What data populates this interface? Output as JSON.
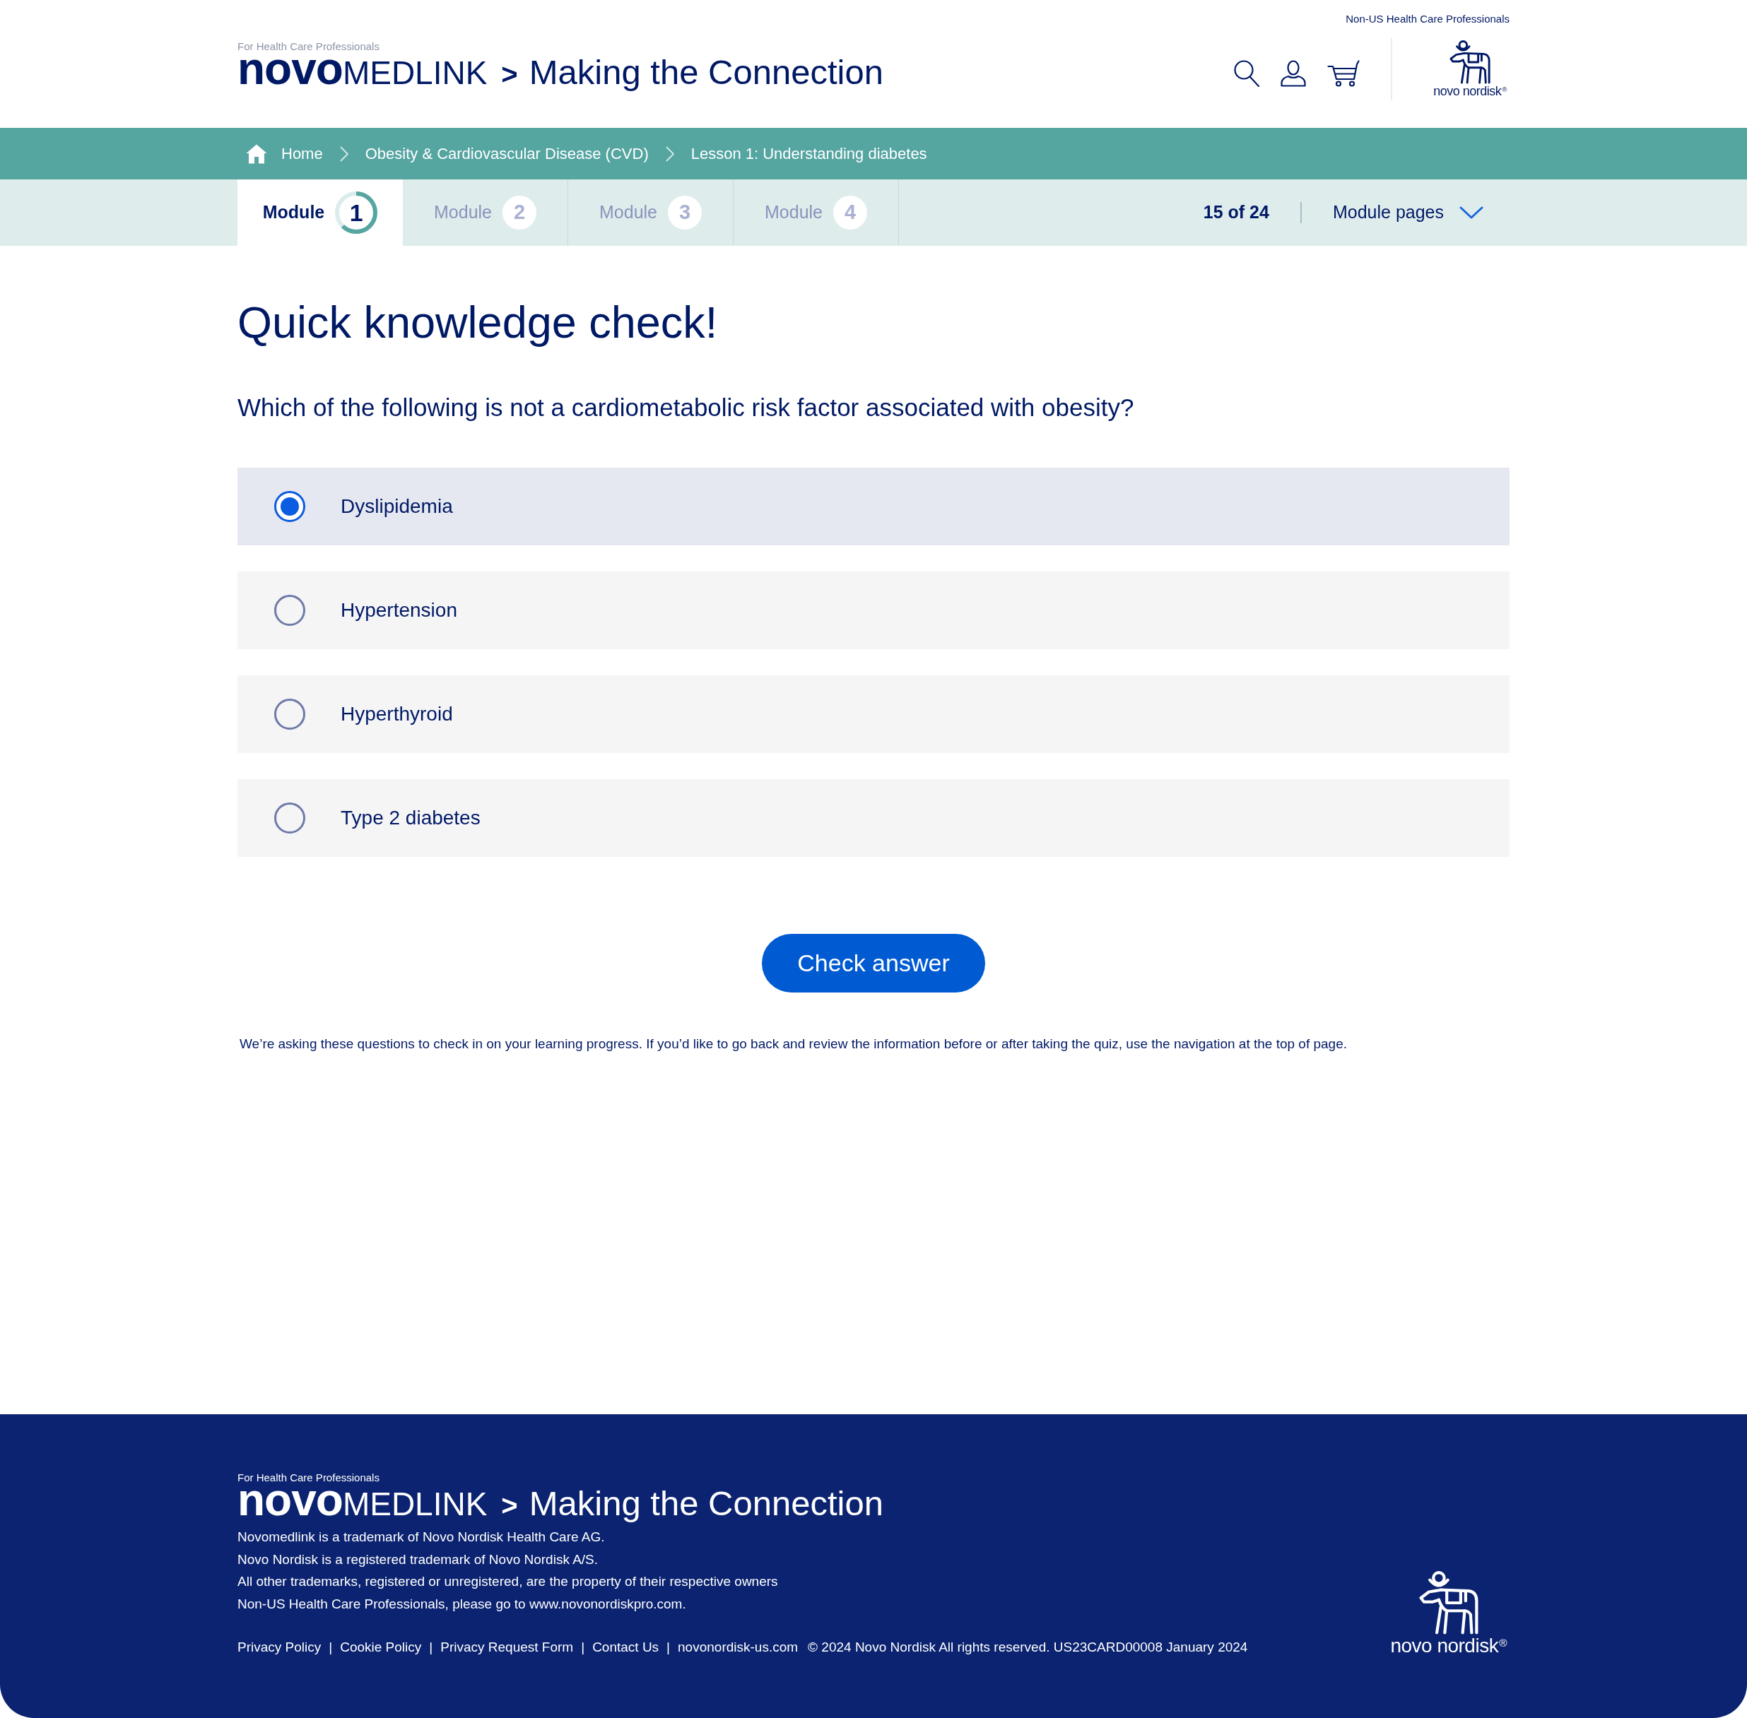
{
  "header": {
    "top_link": "Non-US Health Care Professionals",
    "tagline": "For Health Care Professionals",
    "wordmark": "**novo**MEDLINK",
    "separator": ">",
    "site_title": "Making the Connection",
    "brand_logo": "novo nordisk$^{®}$"
  },
  "breadcrumb": [
    {
      "kind": "home",
      "label": "Home"
    },
    {
      "kind": "link",
      "label": "Obesity & Cardiovascular Disease (CVD)"
    },
    {
      "kind": "link",
      "label": "Lesson 1: Understanding diabetes"
    }
  ],
  "modules": [
    {
      "label": "Module",
      "number": "1",
      "selected": true,
      "level": 0.625
    },
    {
      "label": "Module",
      "number": "2",
      "selected": false
    },
    {
      "label": "Module",
      "number": "3",
      "selected": false
    },
    {
      "label": "Module",
      "number": "4",
      "selected": false
    }
  ],
  "page_counter": "15 of 24",
  "module_pages": {
    "label": "Module pages"
  },
  "quiz": {
    "title": "Quick knowledge check!",
    "question": "Which of the following is not a cardiometabolic risk factor associated with obesity?",
    "options": [
      {
        "label": "Dyslipidemia",
        "selected": true
      },
      {
        "label": "Hypertension",
        "selected": false
      },
      {
        "label": "Hyperthyroid",
        "selected": false
      },
      {
        "label": "Type 2 diabetes",
        "selected": false
      }
    ],
    "button": "Check answer",
    "note": "We’re asking these questions to check in on your learning progress. If you’d like to go back and review the information before or after taking the quiz, use the navigation at the top of page."
  },
  "footer": {
    "tagline": "For Health Care Professionals",
    "wordmark": "**novo**MEDLINK",
    "separator": ">",
    "site_title": "Making the Connection",
    "notices": [
      "Novomedlink is a trademark of Novo Nordisk Health Care AG.",
      "Novo Nordisk is a registered trademark of Novo Nordisk A/S.",
      "All other trademarks, registered or unregistered, are the property of their respective owners",
      "Non-US Health Care Professionals, please go to www.novonordiskpro.com."
    ],
    "links": [
      {
        "label": "Privacy Policy",
        "separator_after": "|"
      },
      {
        "label": "Cookie Policy",
        "separator_after": "|"
      },
      {
        "label": "Privacy Request Form",
        "separator_after": "|"
      },
      {
        "label": "Contact Us",
        "separator_after": "|"
      },
      {
        "label": "novonordisk-us.com"
      }
    ],
    "copyright": "© 2024 Novo Nordisk All rights reserved. US23CARD00008 January 2024",
    "brand_logo": "novo nordisk$^{®}$"
  }
}
